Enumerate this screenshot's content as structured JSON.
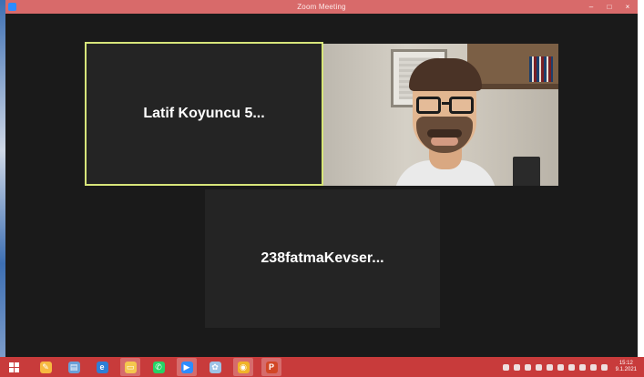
{
  "window": {
    "title": "Zoom Meeting",
    "controls": {
      "minimize": "–",
      "maximize": "□",
      "close": "×"
    }
  },
  "participants": [
    {
      "name": "Latif Koyuncu 5...",
      "video": false,
      "active_speaker": true
    },
    {
      "name": "",
      "video": true,
      "active_speaker": false
    },
    {
      "name": "238fatmaKevser...",
      "video": false,
      "active_speaker": false
    }
  ],
  "colors": {
    "titlebar": "#d86a6a",
    "stage_background": "#1a1a1a",
    "tile_background": "#242424",
    "active_speaker_border": "#d7e57a",
    "taskbar": "#c83b3b"
  },
  "taskbar": {
    "apps": [
      {
        "icon": "paint-icon",
        "color": "#f7b940",
        "glyph": "✎",
        "active": false
      },
      {
        "icon": "notebook-icon",
        "color": "#6aa0d8",
        "glyph": "▤",
        "active": false
      },
      {
        "icon": "internet-explorer-icon",
        "color": "#2f7fd6",
        "glyph": "e",
        "active": false
      },
      {
        "icon": "file-explorer-icon",
        "color": "#f4c74e",
        "glyph": "▭",
        "active": true
      },
      {
        "icon": "whatsapp-icon",
        "color": "#25d366",
        "glyph": "✆",
        "active": false
      },
      {
        "icon": "zoom-icon",
        "color": "#2d8cff",
        "glyph": "▶",
        "active": true
      },
      {
        "icon": "paint-palette-icon",
        "color": "#9ec3e6",
        "glyph": "✿",
        "active": false
      },
      {
        "icon": "chrome-icon",
        "color": "#f0b429",
        "glyph": "◉",
        "active": true
      },
      {
        "icon": "powerpoint-icon",
        "color": "#d24726",
        "glyph": "P",
        "active": true
      }
    ],
    "tray_icons": [
      "zoom-tray-icon",
      "security-icon",
      "notification-icon",
      "sync-icon",
      "battery-icon",
      "network-icon",
      "display-icon",
      "volume-icon",
      "flag-icon",
      "keyboard-icon"
    ],
    "clock": {
      "time": "15:12",
      "date": "9.1.2021"
    }
  }
}
